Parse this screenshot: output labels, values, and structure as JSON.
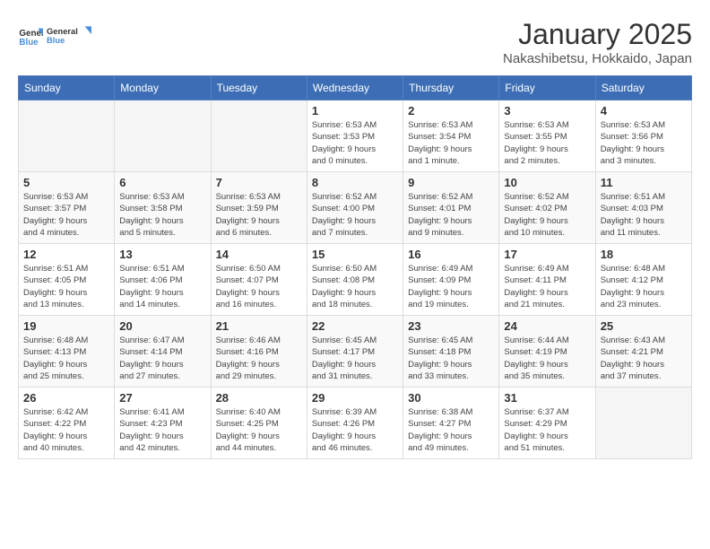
{
  "logo": {
    "line1": "General",
    "line2": "Blue"
  },
  "title": "January 2025",
  "subtitle": "Nakashibetsu, Hokkaido, Japan",
  "days_of_week": [
    "Sunday",
    "Monday",
    "Tuesday",
    "Wednesday",
    "Thursday",
    "Friday",
    "Saturday"
  ],
  "weeks": [
    [
      {
        "day": "",
        "detail": ""
      },
      {
        "day": "",
        "detail": ""
      },
      {
        "day": "",
        "detail": ""
      },
      {
        "day": "1",
        "detail": "Sunrise: 6:53 AM\nSunset: 3:53 PM\nDaylight: 9 hours\nand 0 minutes."
      },
      {
        "day": "2",
        "detail": "Sunrise: 6:53 AM\nSunset: 3:54 PM\nDaylight: 9 hours\nand 1 minute."
      },
      {
        "day": "3",
        "detail": "Sunrise: 6:53 AM\nSunset: 3:55 PM\nDaylight: 9 hours\nand 2 minutes."
      },
      {
        "day": "4",
        "detail": "Sunrise: 6:53 AM\nSunset: 3:56 PM\nDaylight: 9 hours\nand 3 minutes."
      }
    ],
    [
      {
        "day": "5",
        "detail": "Sunrise: 6:53 AM\nSunset: 3:57 PM\nDaylight: 9 hours\nand 4 minutes."
      },
      {
        "day": "6",
        "detail": "Sunrise: 6:53 AM\nSunset: 3:58 PM\nDaylight: 9 hours\nand 5 minutes."
      },
      {
        "day": "7",
        "detail": "Sunrise: 6:53 AM\nSunset: 3:59 PM\nDaylight: 9 hours\nand 6 minutes."
      },
      {
        "day": "8",
        "detail": "Sunrise: 6:52 AM\nSunset: 4:00 PM\nDaylight: 9 hours\nand 7 minutes."
      },
      {
        "day": "9",
        "detail": "Sunrise: 6:52 AM\nSunset: 4:01 PM\nDaylight: 9 hours\nand 9 minutes."
      },
      {
        "day": "10",
        "detail": "Sunrise: 6:52 AM\nSunset: 4:02 PM\nDaylight: 9 hours\nand 10 minutes."
      },
      {
        "day": "11",
        "detail": "Sunrise: 6:51 AM\nSunset: 4:03 PM\nDaylight: 9 hours\nand 11 minutes."
      }
    ],
    [
      {
        "day": "12",
        "detail": "Sunrise: 6:51 AM\nSunset: 4:05 PM\nDaylight: 9 hours\nand 13 minutes."
      },
      {
        "day": "13",
        "detail": "Sunrise: 6:51 AM\nSunset: 4:06 PM\nDaylight: 9 hours\nand 14 minutes."
      },
      {
        "day": "14",
        "detail": "Sunrise: 6:50 AM\nSunset: 4:07 PM\nDaylight: 9 hours\nand 16 minutes."
      },
      {
        "day": "15",
        "detail": "Sunrise: 6:50 AM\nSunset: 4:08 PM\nDaylight: 9 hours\nand 18 minutes."
      },
      {
        "day": "16",
        "detail": "Sunrise: 6:49 AM\nSunset: 4:09 PM\nDaylight: 9 hours\nand 19 minutes."
      },
      {
        "day": "17",
        "detail": "Sunrise: 6:49 AM\nSunset: 4:11 PM\nDaylight: 9 hours\nand 21 minutes."
      },
      {
        "day": "18",
        "detail": "Sunrise: 6:48 AM\nSunset: 4:12 PM\nDaylight: 9 hours\nand 23 minutes."
      }
    ],
    [
      {
        "day": "19",
        "detail": "Sunrise: 6:48 AM\nSunset: 4:13 PM\nDaylight: 9 hours\nand 25 minutes."
      },
      {
        "day": "20",
        "detail": "Sunrise: 6:47 AM\nSunset: 4:14 PM\nDaylight: 9 hours\nand 27 minutes."
      },
      {
        "day": "21",
        "detail": "Sunrise: 6:46 AM\nSunset: 4:16 PM\nDaylight: 9 hours\nand 29 minutes."
      },
      {
        "day": "22",
        "detail": "Sunrise: 6:45 AM\nSunset: 4:17 PM\nDaylight: 9 hours\nand 31 minutes."
      },
      {
        "day": "23",
        "detail": "Sunrise: 6:45 AM\nSunset: 4:18 PM\nDaylight: 9 hours\nand 33 minutes."
      },
      {
        "day": "24",
        "detail": "Sunrise: 6:44 AM\nSunset: 4:19 PM\nDaylight: 9 hours\nand 35 minutes."
      },
      {
        "day": "25",
        "detail": "Sunrise: 6:43 AM\nSunset: 4:21 PM\nDaylight: 9 hours\nand 37 minutes."
      }
    ],
    [
      {
        "day": "26",
        "detail": "Sunrise: 6:42 AM\nSunset: 4:22 PM\nDaylight: 9 hours\nand 40 minutes."
      },
      {
        "day": "27",
        "detail": "Sunrise: 6:41 AM\nSunset: 4:23 PM\nDaylight: 9 hours\nand 42 minutes."
      },
      {
        "day": "28",
        "detail": "Sunrise: 6:40 AM\nSunset: 4:25 PM\nDaylight: 9 hours\nand 44 minutes."
      },
      {
        "day": "29",
        "detail": "Sunrise: 6:39 AM\nSunset: 4:26 PM\nDaylight: 9 hours\nand 46 minutes."
      },
      {
        "day": "30",
        "detail": "Sunrise: 6:38 AM\nSunset: 4:27 PM\nDaylight: 9 hours\nand 49 minutes."
      },
      {
        "day": "31",
        "detail": "Sunrise: 6:37 AM\nSunset: 4:29 PM\nDaylight: 9 hours\nand 51 minutes."
      },
      {
        "day": "",
        "detail": ""
      }
    ]
  ]
}
